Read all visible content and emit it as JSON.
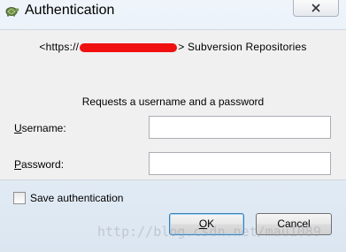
{
  "window": {
    "title": "Authentication"
  },
  "prompt": {
    "repo_prefix": "<https://",
    "repo_suffix": "> Subversion Repositories",
    "request_text": "Requests a username and a password"
  },
  "fields": {
    "username": {
      "label_first": "U",
      "label_rest": "sername:",
      "value": "",
      "placeholder": ""
    },
    "password": {
      "label_first": "P",
      "label_rest": "assword:",
      "value": "",
      "placeholder": ""
    }
  },
  "save": {
    "label": "Save authentication",
    "checked": false
  },
  "buttons": {
    "ok": {
      "label_first": "O",
      "label_rest": "K"
    },
    "cancel": {
      "label": "Cancel"
    }
  },
  "watermark": "http://blog.csdn.net/mau1089",
  "colors": {
    "redaction": "#f01010",
    "ok_focus": "#3c7fb1"
  }
}
